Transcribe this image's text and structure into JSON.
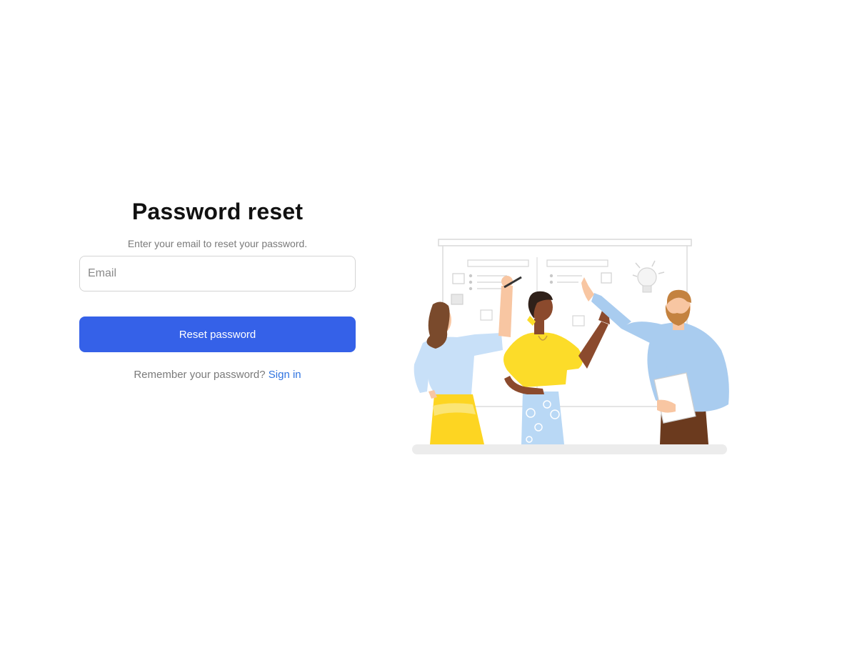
{
  "form": {
    "title": "Password reset",
    "subtitle": "Enter your email to reset your password.",
    "email": {
      "placeholder": "Email",
      "value": ""
    },
    "reset_label": "Reset password",
    "footer_text": "Remember your password?",
    "sign_in_label": "Sign in"
  },
  "colors": {
    "primary": "#3561e8",
    "link": "#2f73e0",
    "text_muted": "#7a7a7a",
    "title": "#111111"
  },
  "illustration": {
    "icon": "team-whiteboard-illustration"
  }
}
